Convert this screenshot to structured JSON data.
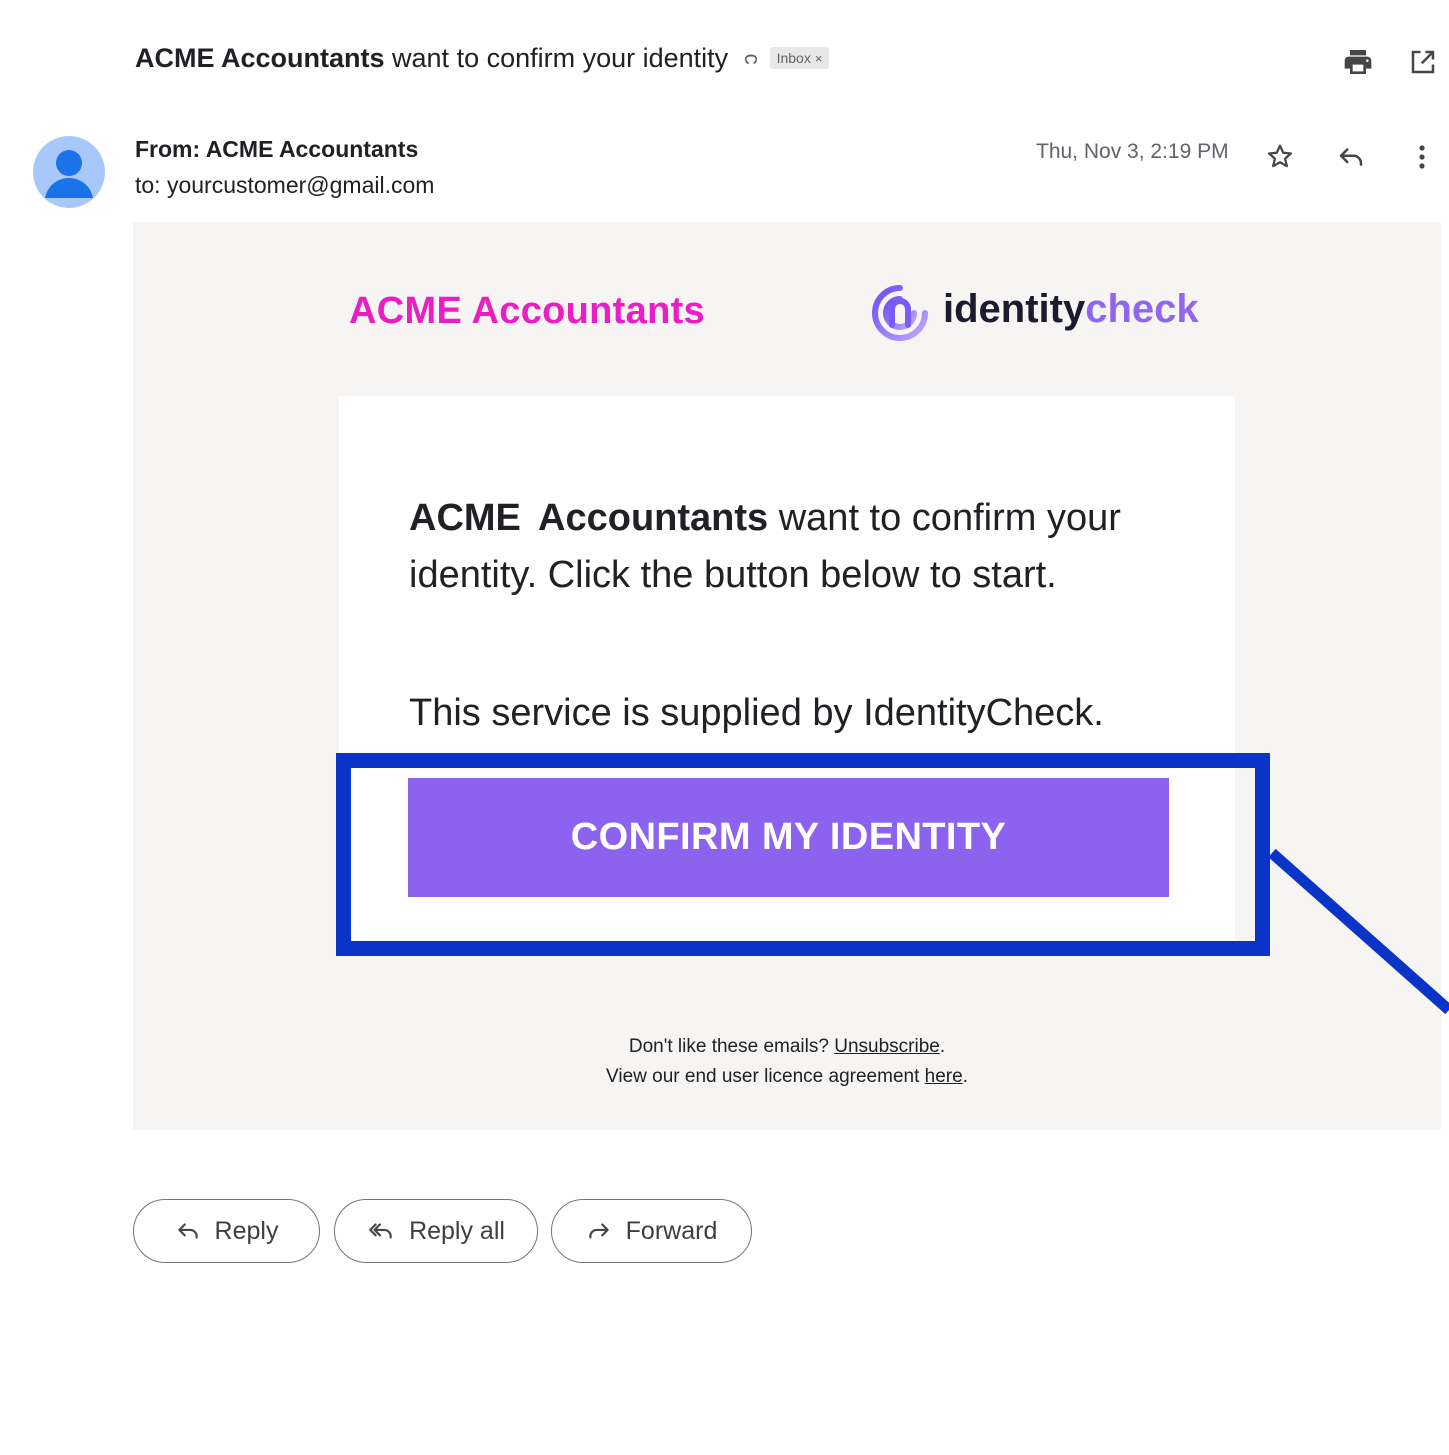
{
  "subject": {
    "sender_bold": "ACME Accountants",
    "text": "want to confirm your identity",
    "label_icon": "label-arrow-icon",
    "inbox_chip": "Inbox",
    "chip_close": "×"
  },
  "header_icons": [
    "print-icon",
    "open-in-new-window-icon"
  ],
  "message_header": {
    "from": "From: ACME Accountants",
    "to": "to: yourcustomer@gmail.com",
    "date": "Thu, Nov 3, 2:19 PM",
    "icons": [
      "star-icon",
      "reply-icon",
      "more-vert-icon"
    ]
  },
  "email": {
    "brand_acme": "ACME Accountants",
    "brand_ic_part1": "identity",
    "brand_ic_part2": "check",
    "intro_bold": "ACME Accountants",
    "intro_rest": "want to confirm your identity. Click the button below to start.",
    "service_line": "This service is supplied by IdentityCheck.",
    "confirm_button": "CONFIRM MY IDENTITY",
    "footer_q": "Don't like these emails?",
    "unsubscribe": "Unsubscribe",
    "footer_licence": "View our end user licence agreement",
    "here": "here",
    "period": "."
  },
  "actions": {
    "reply": "Reply",
    "reply_all": "Reply all",
    "forward": "Forward"
  },
  "colors": {
    "acme_magenta": "#e91ec4",
    "identitycheck_purple": "#8f67ee",
    "confirm_button_bg": "#8b63ef",
    "highlight_blue": "#0a34c8",
    "email_bg": "#f6f5f4"
  }
}
